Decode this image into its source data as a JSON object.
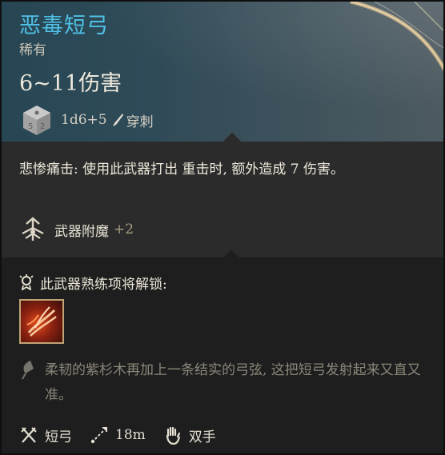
{
  "item": {
    "name": "恶毒短弓",
    "rarity": "稀有",
    "damage": "6~11伤害",
    "dice_formula": "1d6+5",
    "damage_type": "穿刺",
    "icons": {
      "weapon": "bow-icon",
      "dice": "dice-icon",
      "damage_type": "pierce-icon"
    }
  },
  "passive": {
    "text": "悲惨痛击: 使用此武器打出 重击时, 额外造成 7 伤害。"
  },
  "enchantment": {
    "label": "武器附魔",
    "value": "+2",
    "icon": "enchant-icon"
  },
  "proficiency": {
    "header": "此武器熟练项将解锁:",
    "icon": "proficiency-icon",
    "skill_icon": "flame-slash-skill-icon"
  },
  "flavor": {
    "text": "柔韧的紫杉木再加上一条结实的弓弦, 这把短弓发射起来又直又准。",
    "icon": "quill-icon"
  },
  "footer": {
    "weapon_type": "短弓",
    "range": "18m",
    "handedness": "双手",
    "icons": [
      "crossed-weapons-icon",
      "range-icon",
      "hand-icon"
    ]
  },
  "colors": {
    "title": "#4fc1e6",
    "header_bg": "#304b58",
    "section_bg": "#2b2b2b",
    "enchant_value": "#a99e83",
    "flavor_text": "#8c877b"
  }
}
